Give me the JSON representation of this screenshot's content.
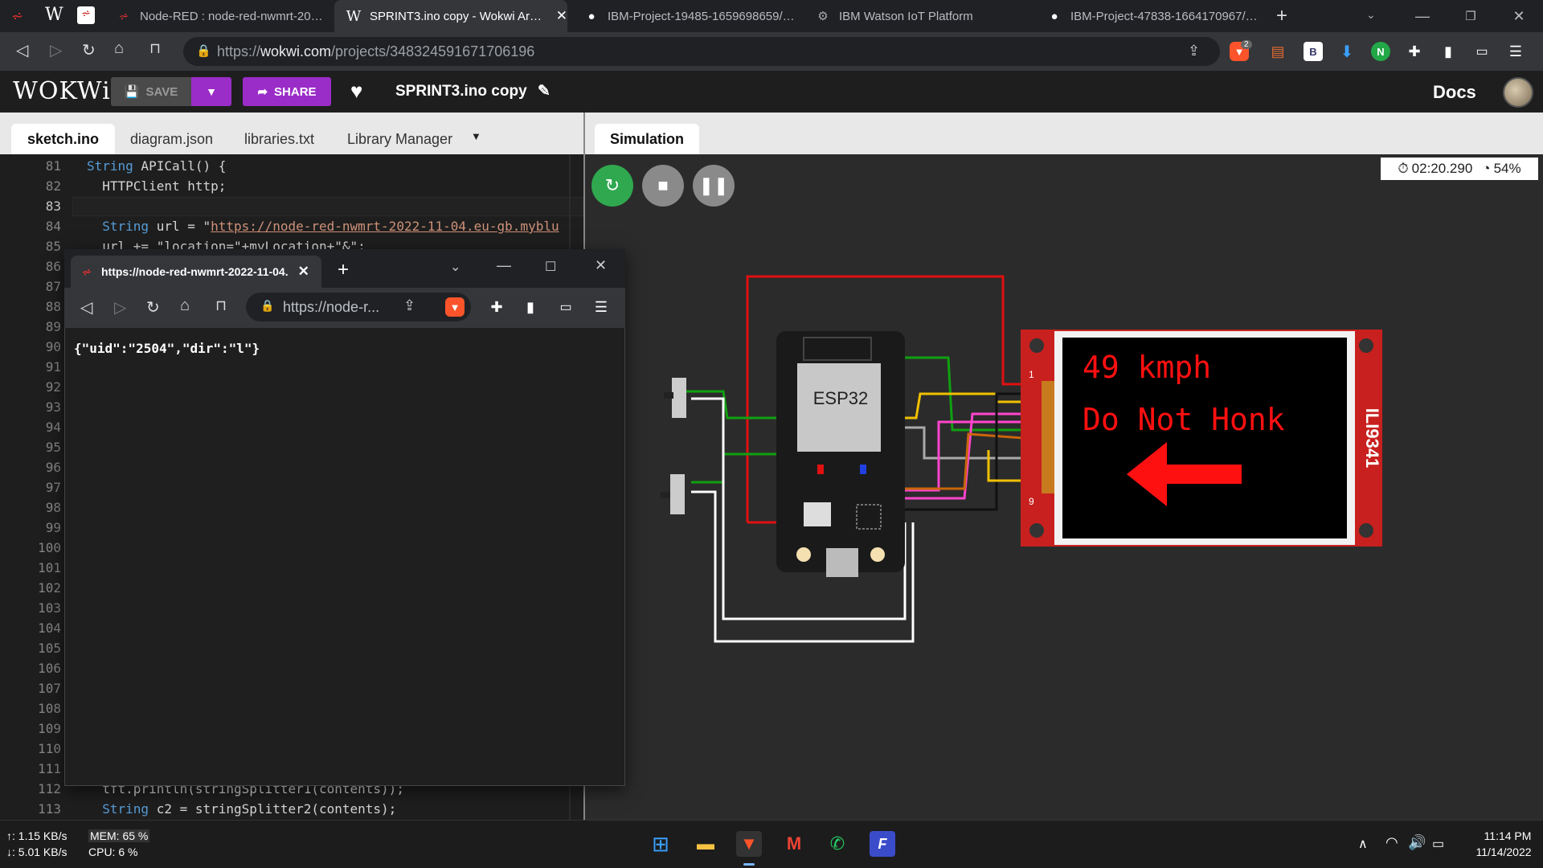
{
  "browser": {
    "tabs": [
      {
        "title": "Node-RED : node-red-nwmrt-2022-1",
        "icon": "node-red-icon"
      },
      {
        "title": "SPRINT3.ino copy - Wokwi Ardui",
        "icon": "wokwi-icon"
      },
      {
        "title": "IBM-Project-19485-1659698659/out",
        "icon": "github-icon"
      },
      {
        "title": "IBM Watson IoT Platform",
        "icon": "ibm-icon"
      },
      {
        "title": "IBM-Project-47838-1664170967/Proj",
        "icon": "github-icon"
      }
    ],
    "url_prefix": "https://",
    "url_host": "wokwi.com",
    "url_path": "/projects/348324591671706196",
    "brave_badge": "2"
  },
  "wokwi": {
    "logo": "WOKWi",
    "save_label": "SAVE",
    "share_label": "SHARE",
    "project_name": "SPRINT3.ino copy",
    "docs_label": "Docs",
    "editor_tabs": [
      "sketch.ino",
      "diagram.json",
      "libraries.txt",
      "Library Manager"
    ],
    "sim_tab": "Simulation",
    "timer": "02:20.290",
    "speed": "54%"
  },
  "code_lines": [
    {
      "n": "81",
      "html": "<span class='kw'>String</span> APICall() {"
    },
    {
      "n": "82",
      "html": "  HTTPClient http;"
    },
    {
      "n": "83",
      "html": ""
    },
    {
      "n": "84",
      "html": "  <span class='kw'>String</span> url = \"<span class='str'>https://node-red-nwmrt-2022-11-04.eu-gb.myblu</span>"
    },
    {
      "n": "85",
      "html": "  url += \"location=\"+myLocation+\"&\";"
    },
    {
      "n": "86",
      "html": ""
    },
    {
      "n": "87",
      "html": ""
    },
    {
      "n": "88",
      "html": ""
    },
    {
      "n": "89",
      "html": ""
    },
    {
      "n": "90",
      "html": ""
    },
    {
      "n": "91",
      "html": ""
    },
    {
      "n": "92",
      "html": ""
    },
    {
      "n": "93",
      "html": ""
    },
    {
      "n": "94",
      "html": ""
    },
    {
      "n": "95",
      "html": ""
    },
    {
      "n": "96",
      "html": ""
    },
    {
      "n": "97",
      "html": ""
    },
    {
      "n": "98",
      "html": ""
    },
    {
      "n": "99",
      "html": ""
    },
    {
      "n": "100",
      "html": ""
    },
    {
      "n": "101",
      "html": ""
    },
    {
      "n": "102",
      "html": ""
    },
    {
      "n": "103",
      "html": ""
    },
    {
      "n": "104",
      "html": ""
    },
    {
      "n": "105",
      "html": ""
    },
    {
      "n": "106",
      "html": ""
    },
    {
      "n": "107",
      "html": ""
    },
    {
      "n": "108",
      "html": ""
    },
    {
      "n": "109",
      "html": ""
    },
    {
      "n": "110",
      "html": ""
    },
    {
      "n": "111",
      "html": ""
    },
    {
      "n": "112",
      "html": "  tft.println(stringSplitter1(contents));"
    },
    {
      "n": "113",
      "html": "  <span class='kw'>String</span> c2 = stringSplitter2(contents);"
    }
  ],
  "circuit": {
    "esp32_label": "ESP32",
    "display_label": "ILI9341",
    "display_line1": "49 kmph",
    "display_line2": "Do Not Honk",
    "pin_top": "1",
    "pin_bottom": "9"
  },
  "popup": {
    "tab_title": "https://node-red-nwmrt-2022-11-04.",
    "url": "https://node-r...",
    "json_text": "{\"uid\":\"2504\",\"dir\":\"l\"}"
  },
  "taskbar": {
    "net_up": "↑: 1.15 KB/s",
    "net_down": "↓: 5.01 KB/s",
    "mem": "MEM: 65 %",
    "cpu": "CPU: 6 %",
    "time": "11:14 PM",
    "date": "11/14/2022"
  }
}
